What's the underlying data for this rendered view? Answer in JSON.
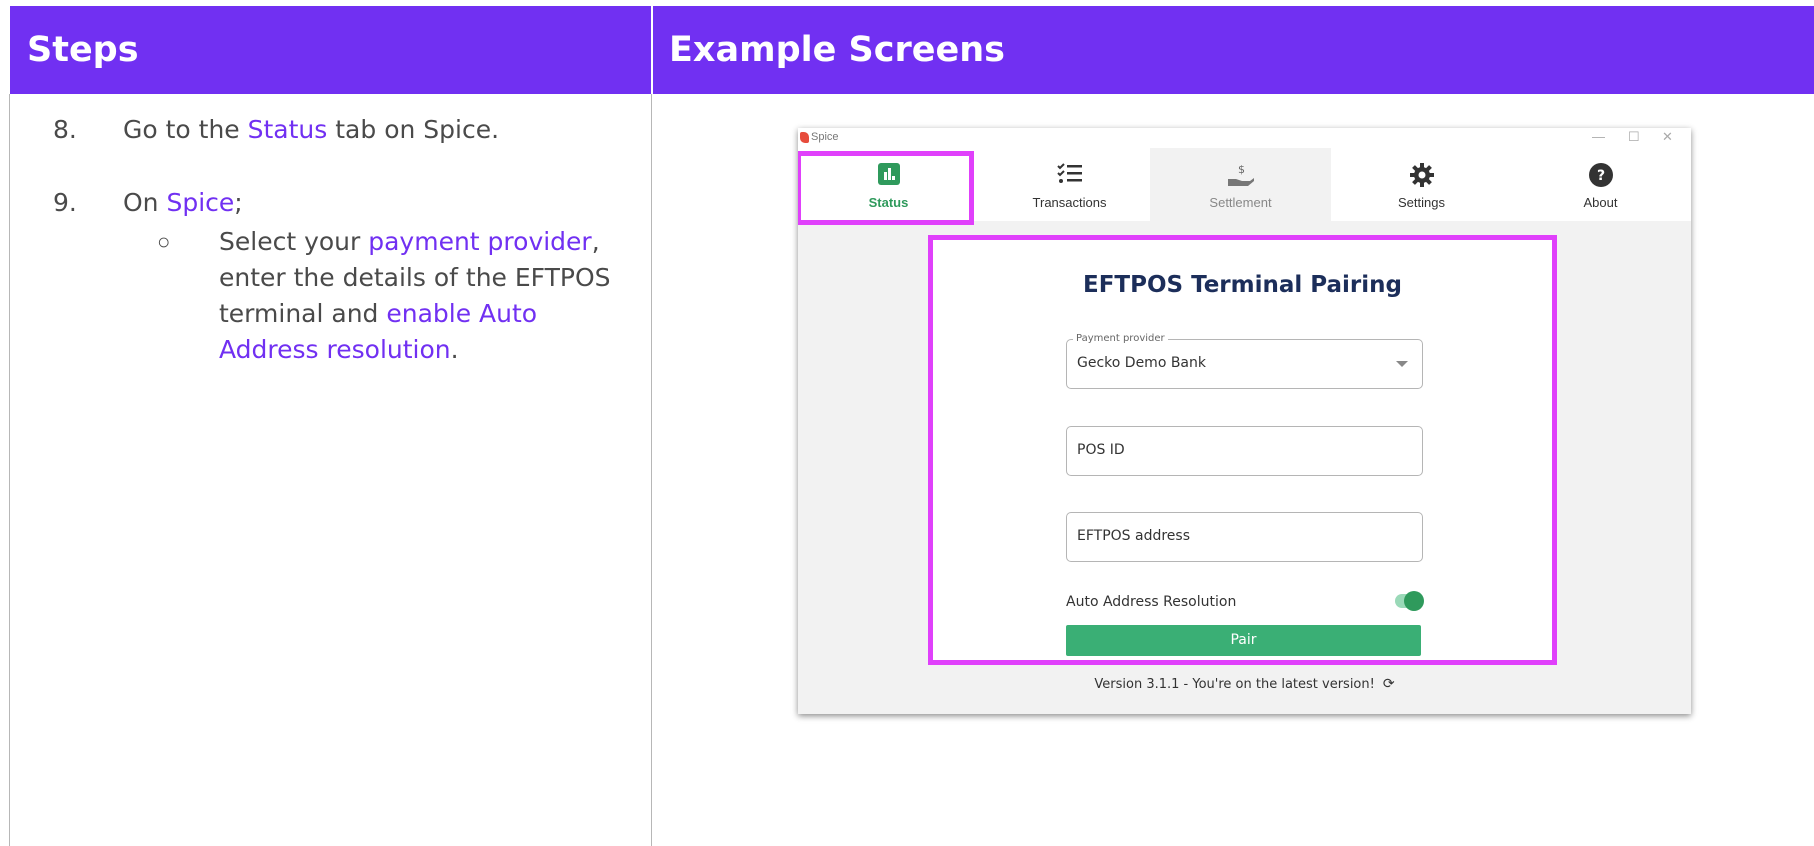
{
  "header": {
    "steps_label": "Steps",
    "examples_label": "Example Screens"
  },
  "steps": {
    "step8": {
      "number": "8.",
      "prefix": "Go to the ",
      "link": "Status",
      "suffix": " tab on Spice."
    },
    "step9": {
      "number": "9.",
      "prefix": "On ",
      "link": "Spice",
      "suffix": ";",
      "bullet": "○",
      "bullet_parts": {
        "p1": "Select your ",
        "l1": "payment provider",
        "p2": ", enter the details of the EFTPOS terminal and ",
        "l2": "enable Auto Address resolution",
        "p3": "."
      }
    }
  },
  "app": {
    "title": "Spice",
    "window_controls": {
      "minimize": "—",
      "maximize": "☐",
      "close": "✕"
    },
    "tabs": [
      {
        "label": "Status",
        "icon": "bar-chart-icon"
      },
      {
        "label": "Transactions",
        "icon": "checklist-icon"
      },
      {
        "label": "Settlement",
        "icon": "hand-dollar-icon"
      },
      {
        "label": "Settings",
        "icon": "gear-icon"
      },
      {
        "label": "About",
        "icon": "help-circle-icon"
      }
    ],
    "pairing": {
      "title": "EFTPOS Terminal Pairing",
      "provider_legend": "Payment provider",
      "provider_value": "Gecko Demo Bank",
      "pos_id_placeholder": "POS ID",
      "eftpos_address_placeholder": "EFTPOS address",
      "auto_address_label": "Auto Address Resolution",
      "auto_address_enabled": true,
      "pair_button": "Pair"
    },
    "version_text": "Version 3.1.1 - You're on the latest version!",
    "refresh_glyph": "⟳"
  },
  "colors": {
    "accent": "#7130f2",
    "highlight": "#e040fb",
    "green": "#3aaf75"
  }
}
